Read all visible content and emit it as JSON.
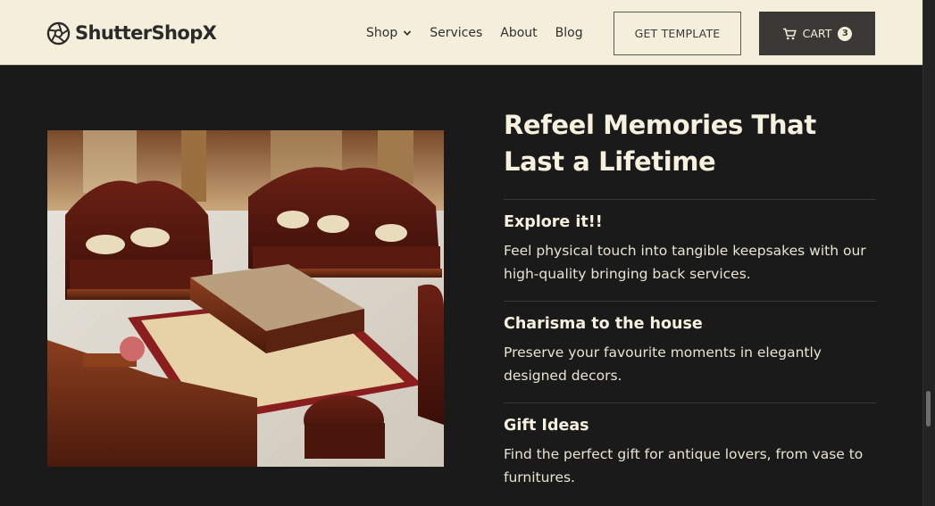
{
  "brand": {
    "name": "ShutterShopX",
    "icon": "aperture-icon"
  },
  "nav": {
    "items": [
      {
        "label": "Shop",
        "has_dropdown": true
      },
      {
        "label": "Services"
      },
      {
        "label": "About"
      },
      {
        "label": "Blog"
      }
    ]
  },
  "header_buttons": {
    "template_label": "GET TEMPLATE",
    "cart_label": "CART",
    "cart_count": "3"
  },
  "hero": {
    "image_alt_icon": "furniture-photo",
    "headline": "Refeel Memories That Last a Lifetime",
    "features": [
      {
        "title": "Explore it!!",
        "description": "Feel physical touch into tangible keepsakes with our high-quality bringing back services."
      },
      {
        "title": "Charisma to the house",
        "description": "Preserve your favourite moments in elegantly designed decors."
      },
      {
        "title": "Gift Ideas",
        "description": "Find the perfect gift for antique lovers, from vase to furnitures."
      }
    ]
  },
  "colors": {
    "header_bg": "#f3efdb",
    "page_bg": "#1a1a1a",
    "cart_button_bg": "#3b3936",
    "text_light": "#f6f1df"
  }
}
